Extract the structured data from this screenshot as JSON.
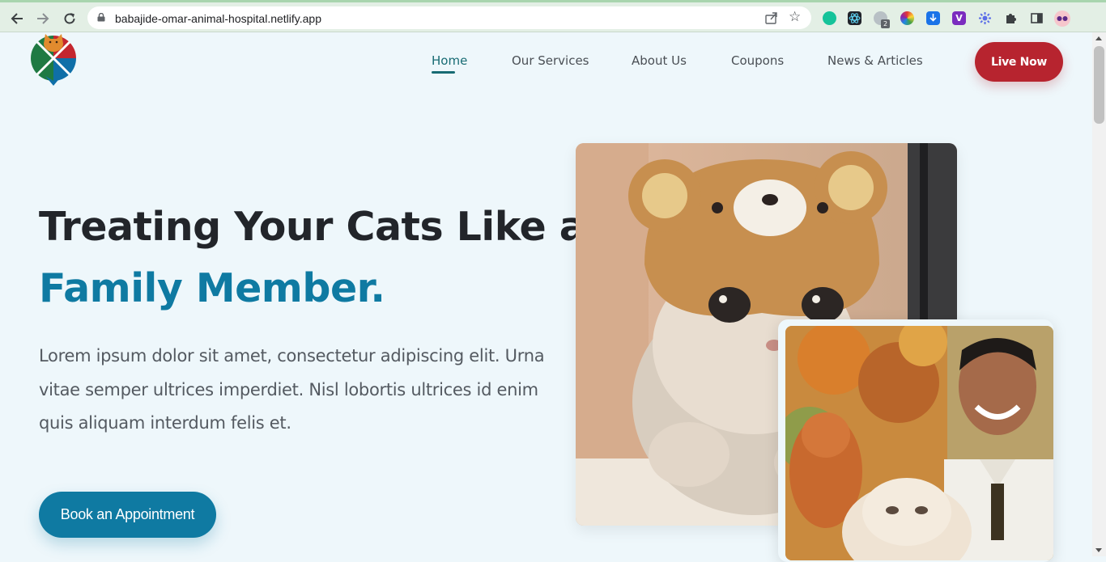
{
  "browser": {
    "url": "babajide-omar-animal-hospital.netlify.app",
    "extension_badge": "2",
    "back_icon": "arrow-left",
    "forward_icon": "arrow-right",
    "reload_icon": "reload",
    "extensions": [
      "grammarly-icon",
      "react-devtools-icon",
      "extension-badge-icon",
      "color-picker-icon",
      "download-icon",
      "vimeo-icon",
      "settings-gear-icon",
      "puzzle-icon",
      "sidepanel-icon",
      "profile-avatar-icon"
    ]
  },
  "nav": {
    "items": [
      {
        "label": "Home",
        "active": true
      },
      {
        "label": "Our Services",
        "active": false
      },
      {
        "label": "About Us",
        "active": false
      },
      {
        "label": "Coupons",
        "active": false
      },
      {
        "label": "News & Articles",
        "active": false
      }
    ],
    "live_button": "Live Now"
  },
  "hero": {
    "title_line1": "Treating Your Cats Like a",
    "title_line2": "Family Member.",
    "description": "Lorem ipsum dolor sit amet, consectetur adipiscing elit. Urna vitae semper ultrices imperdiet. Nisl lobortis ultrices id enim quis aliquam interdum felis et.",
    "cta": "Book an Appointment"
  },
  "colors": {
    "accent_teal": "#176b73",
    "accent_blue": "#0f7aa2",
    "live_red": "#b7242f",
    "background": "#eef7fb"
  }
}
